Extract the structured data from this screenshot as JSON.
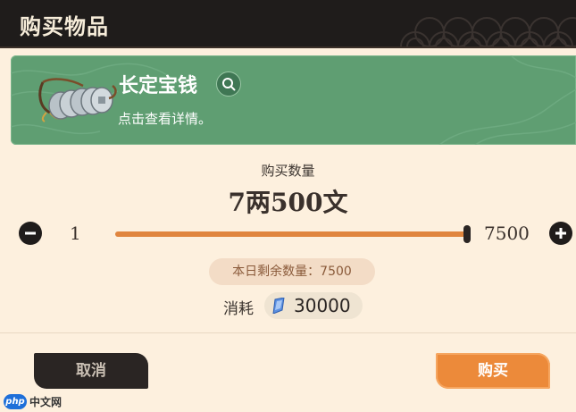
{
  "header": {
    "title": "购买物品"
  },
  "item": {
    "name": "长定宝钱",
    "description": "点击查看详情。"
  },
  "purchase": {
    "quantity_label": "购买数量",
    "price_text": "7两500文",
    "min_value": "1",
    "max_value": "7500",
    "slider_fraction": 1.0,
    "remaining_text": "本日剩余数量：7500",
    "cost_label": "消耗",
    "cost_value": "30000"
  },
  "buttons": {
    "cancel": "取消",
    "buy": "购买"
  },
  "watermark": {
    "logo": "php",
    "text": "中文网"
  },
  "colors": {
    "accent": "#ec8a3a",
    "card": "#5f9e72",
    "dark": "#1f1c1b",
    "background": "#fdf0de"
  }
}
